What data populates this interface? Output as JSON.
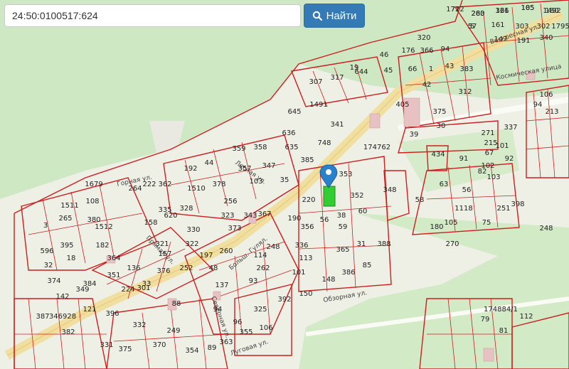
{
  "search": {
    "value": "24:50:0100517:624",
    "button_label": "Найти",
    "button_color": "#337ab7",
    "icon": "search-icon"
  },
  "map": {
    "marker_icon": "map-pin-icon",
    "selected_parcel": "624",
    "colors": {
      "parcel_stroke": "#cc1f1f",
      "forest": "#cfe8c4",
      "road": "#f1dfa2",
      "selected": "#33cc33",
      "marker": "#2a81cb"
    },
    "streets": [
      "Воскресная ул.",
      "Космическая улица",
      "Горная ул.",
      "Лесная ул.",
      "Прямая ул.",
      "Обзорная ул.",
      "Больш. Гулял.",
      "Северная ул.",
      "Луговая ул."
    ],
    "parcel_labels": [
      "1722",
      "263",
      "326",
      "105",
      "1492",
      "57",
      "161",
      "303",
      "302",
      "1795",
      "147",
      "191",
      "340",
      "46",
      "176",
      "366",
      "94",
      "320",
      "45",
      "66",
      "1",
      "43",
      "383",
      "19",
      "307",
      "317",
      "644",
      "42",
      "312",
      "375",
      "645",
      "1491",
      "405",
      "30",
      "636",
      "341",
      "39",
      "635",
      "748",
      "385",
      "174762",
      "353",
      "348",
      "434",
      "220",
      "352",
      "1679",
      "359",
      "358",
      "357",
      "347",
      "103",
      "35",
      "1511",
      "108",
      "264",
      "222",
      "362",
      "192",
      "44",
      "378",
      "1510",
      "256",
      "335",
      "328",
      "323",
      "343",
      "3",
      "265",
      "380",
      "1512",
      "158",
      "620",
      "330",
      "373",
      "367",
      "190",
      "356",
      "56",
      "38",
      "60",
      "59",
      "596",
      "395",
      "182",
      "321",
      "364",
      "157",
      "322",
      "197",
      "260",
      "248",
      "336",
      "114",
      "31",
      "388",
      "32",
      "18",
      "136",
      "252",
      "48",
      "262",
      "113",
      "365",
      "85",
      "374",
      "351",
      "376",
      "33",
      "137",
      "93",
      "101",
      "148",
      "386",
      "142",
      "349",
      "384",
      "224",
      "301",
      "88",
      "94",
      "325",
      "392",
      "150",
      "387",
      "346928",
      "121",
      "396",
      "332",
      "96",
      "355",
      "106",
      "382",
      "331",
      "375",
      "370",
      "89",
      "354",
      "363",
      "249",
      "271",
      "337",
      "215",
      "101",
      "92",
      "67",
      "102",
      "103",
      "91",
      "82",
      "63",
      "56",
      "58",
      "1118",
      "251",
      "398",
      "75",
      "248",
      "180",
      "105",
      "270",
      "112",
      "174884/1",
      "79",
      "81",
      "94",
      "213",
      "106",
      "71",
      "280",
      "161",
      "185",
      "180",
      "5"
    ]
  }
}
